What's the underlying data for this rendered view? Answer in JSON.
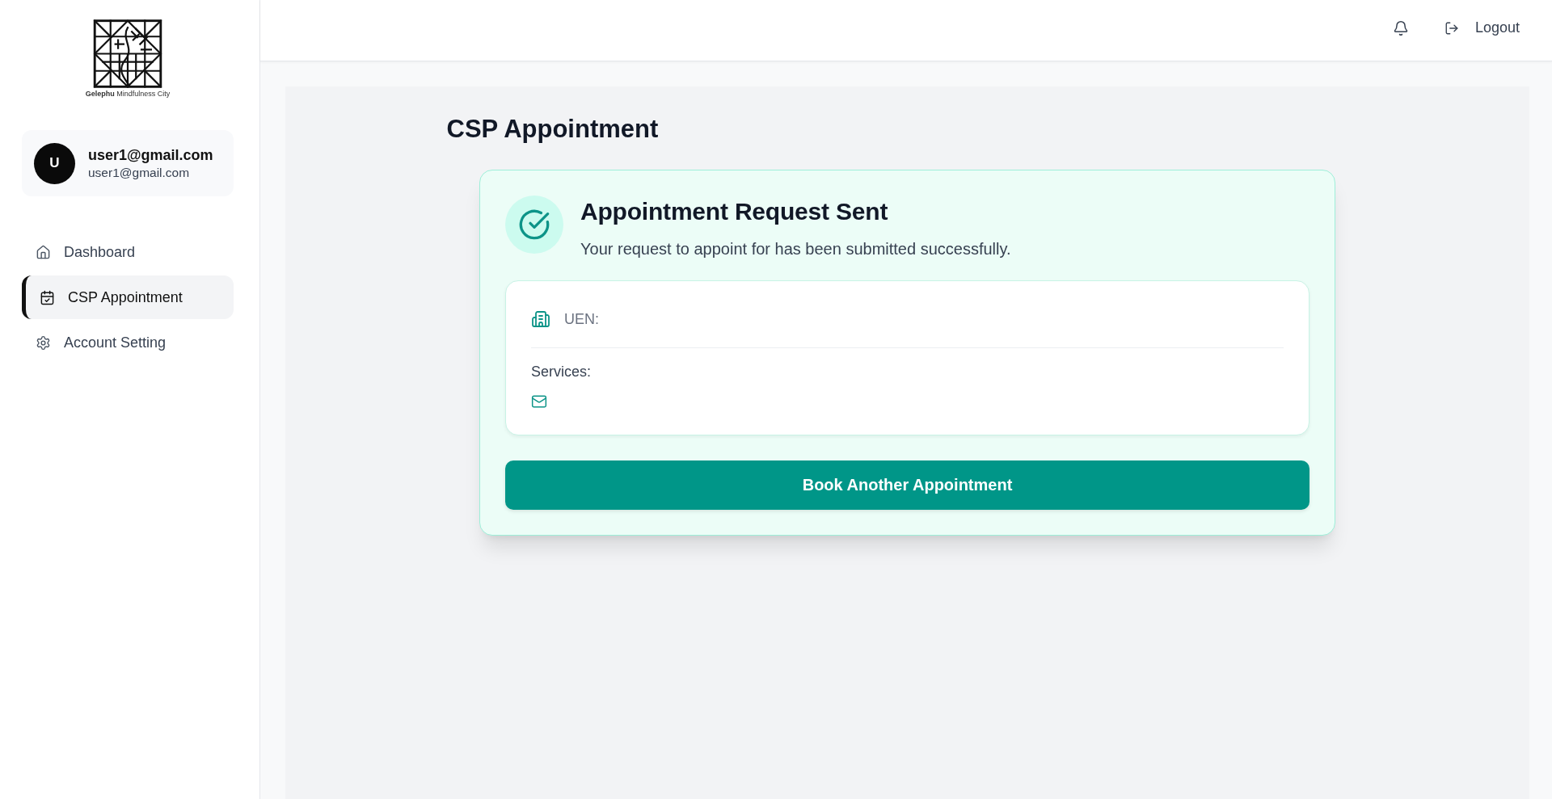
{
  "sidebar": {
    "logo": {
      "caption": "**Gelephu** Mindfulness City"
    },
    "user": {
      "initial": "U",
      "name": "user1@gmail.com",
      "email": "user1@gmail.com"
    },
    "nav_items": [
      {
        "label": "Dashboard",
        "selected": false
      },
      {
        "label": "CSP Appointment",
        "selected": true
      },
      {
        "label": "Account Setting",
        "selected": false
      }
    ]
  },
  "top_bar": {
    "logout_label": "Logout"
  },
  "page_title": "CSP Appointment",
  "confirmation": {
    "title": "Appointment Request Sent",
    "message": "Your request to appoint for has been submitted successfully.",
    "details": {
      "uen_label": "UEN:",
      "services_label": "Services:"
    },
    "button": "Book Another Appointment"
  }
}
